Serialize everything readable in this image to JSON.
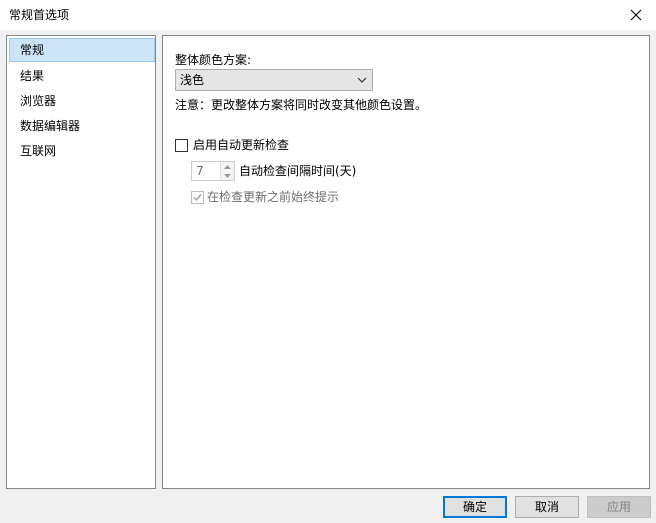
{
  "window": {
    "title": "常规首选项"
  },
  "sidebar": {
    "items": [
      {
        "label": "常规",
        "selected": true
      },
      {
        "label": "结果",
        "selected": false
      },
      {
        "label": "浏览器",
        "selected": false
      },
      {
        "label": "数据编辑器",
        "selected": false
      },
      {
        "label": "互联网",
        "selected": false
      }
    ]
  },
  "general": {
    "color_scheme_label": "整体颜色方案:",
    "color_scheme_value": "浅色",
    "note": "注意：更改整体方案将同时改变其他颜色设置。",
    "auto_update_label": "启用自动更新检查",
    "auto_update_checked": false,
    "interval_value": "7",
    "interval_label": "自动检查间隔时间(天)",
    "prompt_label": "在检查更新之前始终提示",
    "prompt_checked": true
  },
  "buttons": {
    "ok": "确定",
    "cancel": "取消",
    "apply": "应用"
  },
  "icons": {
    "close": "close-icon",
    "dropdown": "chevron-down-icon",
    "spin_up": "spin-up-icon",
    "spin_down": "spin-down-icon",
    "check": "checkmark-icon"
  },
  "colors": {
    "selection": "#cce4f7",
    "default_button_border": "#0078d7"
  }
}
